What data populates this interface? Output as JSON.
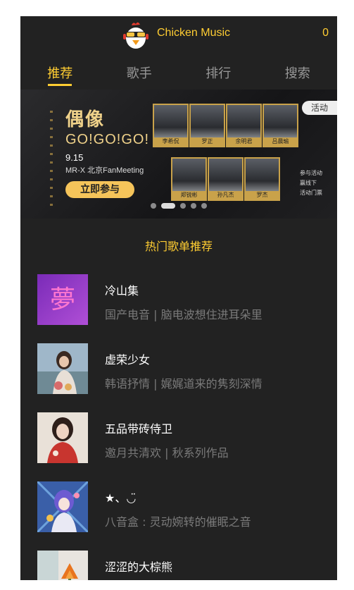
{
  "header": {
    "title": "Chicken Music",
    "count": "0"
  },
  "tabs": [
    {
      "label": "推荐",
      "active": true
    },
    {
      "label": "歌手",
      "active": false
    },
    {
      "label": "排行",
      "active": false
    },
    {
      "label": "搜索",
      "active": false
    }
  ],
  "banner": {
    "title": "偶像",
    "subtitle": "GO!GO!GO!",
    "date": "9.15",
    "event": "MR-X 北京FanMeeting",
    "button": "立即参与",
    "badge": "活动",
    "side_note": [
      "参与活动",
      "赢线下",
      "活动门票"
    ],
    "members": [
      "李希侃",
      "罗正",
      "余明君",
      "吕晨瑜",
      "郑锐彬",
      "孙凡杰",
      "罗杰"
    ],
    "slide_count": 5,
    "active_slide": 1
  },
  "section": {
    "title": "热门歌单推荐"
  },
  "playlists": [
    {
      "name": "冷山集",
      "desc": "国产电音 | 脑电波想住进耳朵里",
      "thumb": "neon-dream"
    },
    {
      "name": "虚荣少女",
      "desc": "韩语抒情 | 娓娓道来的隽刻深情",
      "thumb": "girl-waterside"
    },
    {
      "name": "五品带砖侍卫",
      "desc": "邀月共清欢 | 秋系列作品",
      "thumb": "girl-red"
    },
    {
      "name": "★、◡̈",
      "desc": "八音盒 : 灵动婉转的催眠之音",
      "thumb": "anime-girl"
    },
    {
      "name": "涩涩的大棕熊",
      "desc": "",
      "thumb": "orange-flower"
    }
  ],
  "colors": {
    "accent": "#ffcd32",
    "background": "#222222",
    "muted": "#7a7a7a"
  }
}
